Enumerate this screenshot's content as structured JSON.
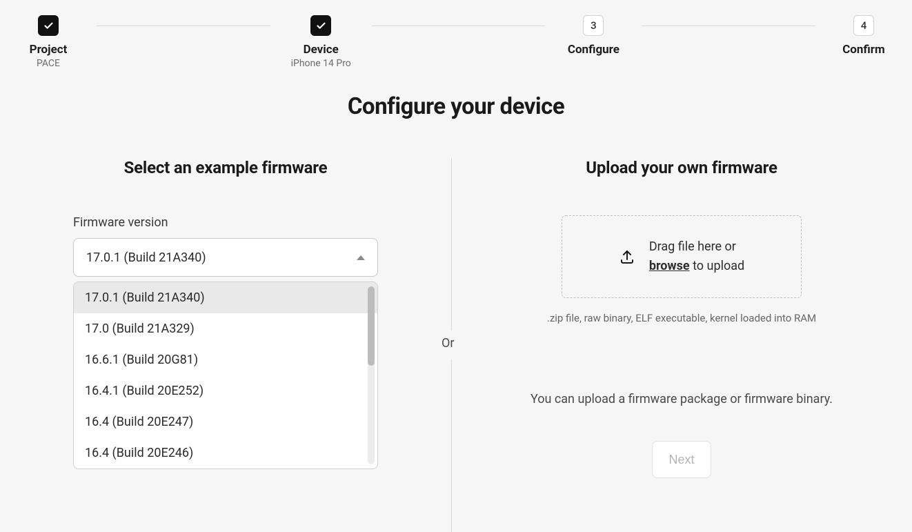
{
  "stepper": {
    "steps": [
      {
        "title": "Project",
        "sub": "PACE",
        "state": "done",
        "num": ""
      },
      {
        "title": "Device",
        "sub": "iPhone 14 Pro",
        "state": "done",
        "num": ""
      },
      {
        "title": "Configure",
        "sub": "",
        "state": "pending",
        "num": "3"
      },
      {
        "title": "Confirm",
        "sub": "",
        "state": "pending",
        "num": "4"
      }
    ]
  },
  "page": {
    "title": "Configure your device",
    "or_label": "Or"
  },
  "left": {
    "heading": "Select an example firmware",
    "field_label": "Firmware version",
    "selected": "17.0.1 (Build 21A340)",
    "options": [
      "17.0.1 (Build 21A340)",
      "17.0 (Build 21A329)",
      "16.6.1 (Build 20G81)",
      "16.4.1 (Build 20E252)",
      "16.4 (Build 20E247)",
      "16.4 (Build 20E246)"
    ]
  },
  "right": {
    "heading": "Upload your own firmware",
    "dropzone_line1": "Drag file here or",
    "dropzone_browse": "browse",
    "dropzone_line2_suffix": " to upload",
    "hint": ".zip file, raw binary, ELF executable, kernel loaded into RAM",
    "note": "You can upload a firmware package or firmware binary.",
    "next_label": "Next"
  }
}
